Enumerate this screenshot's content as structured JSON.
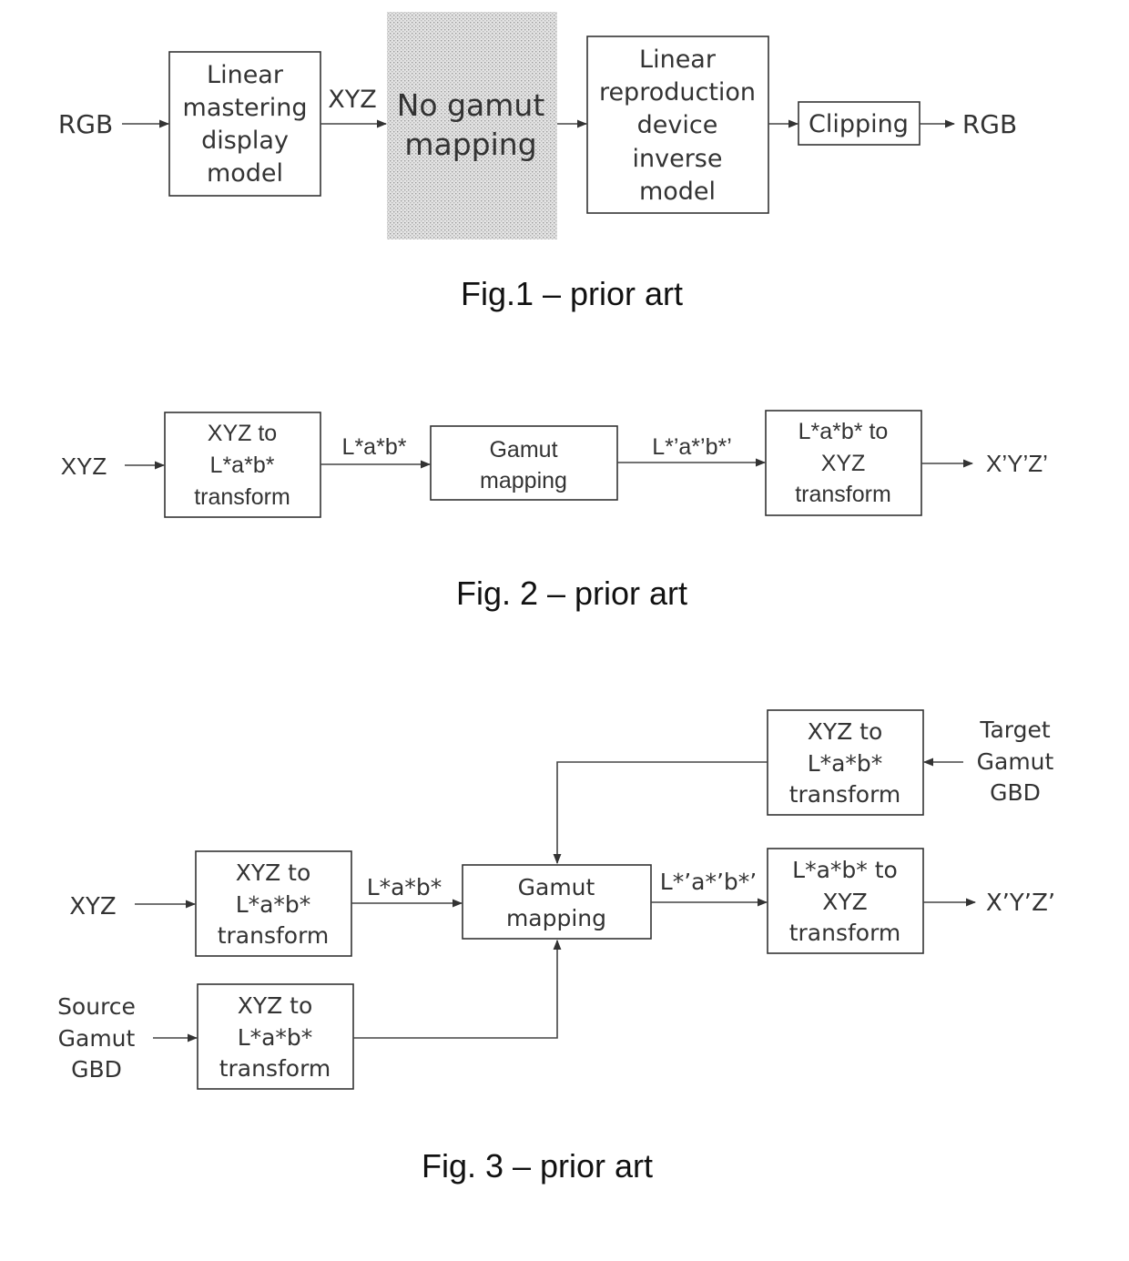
{
  "figures": [
    {
      "id": "fig1",
      "caption": "Fig.1 – prior art",
      "input_label": "RGB",
      "output_label": "RGB",
      "edge_labels": {
        "xyz": "XYZ"
      },
      "blocks": [
        {
          "id": "linear-mastering-display-model",
          "lines": [
            "Linear",
            "mastering",
            "display",
            "model"
          ]
        },
        {
          "id": "no-gamut-mapping",
          "lines": [
            "No gamut",
            "mapping"
          ],
          "shaded": true
        },
        {
          "id": "linear-reproduction-device-inverse-model",
          "lines": [
            "Linear",
            "reproduction",
            "device",
            "inverse",
            "model"
          ]
        },
        {
          "id": "clipping",
          "lines": [
            "Clipping"
          ]
        }
      ]
    },
    {
      "id": "fig2",
      "caption": "Fig. 2 – prior art",
      "input_label": "XYZ",
      "output_label": "X’Y’Z’",
      "edge_labels": {
        "lab": "L*a*b*",
        "lab_prime": "L*’a*’b*’"
      },
      "blocks": [
        {
          "id": "xyz-to-lab-transform",
          "lines": [
            "XYZ to",
            "L*a*b*",
            "transform"
          ]
        },
        {
          "id": "gamut-mapping",
          "lines": [
            "Gamut",
            "mapping"
          ]
        },
        {
          "id": "lab-to-xyz-transform",
          "lines": [
            "L*a*b* to",
            "XYZ",
            "transform"
          ]
        }
      ]
    },
    {
      "id": "fig3",
      "caption": "Fig. 3 – prior art",
      "input_label": "XYZ",
      "output_label": "X’Y’Z’",
      "source_label": [
        "Source",
        "Gamut",
        "GBD"
      ],
      "target_label": [
        "Target",
        "Gamut",
        "GBD"
      ],
      "edge_labels": {
        "lab": "L*a*b*",
        "lab_prime": "L*’a*’b*’"
      },
      "blocks": [
        {
          "id": "xyz-to-lab-transform-main",
          "lines": [
            "XYZ to",
            "L*a*b*",
            "transform"
          ]
        },
        {
          "id": "gamut-mapping",
          "lines": [
            "Gamut",
            "mapping"
          ]
        },
        {
          "id": "lab-to-xyz-transform",
          "lines": [
            "L*a*b* to",
            "XYZ",
            "transform"
          ]
        },
        {
          "id": "xyz-to-lab-transform-target",
          "lines": [
            "XYZ to",
            "L*a*b*",
            "transform"
          ]
        },
        {
          "id": "xyz-to-lab-transform-source",
          "lines": [
            "XYZ to",
            "L*a*b*",
            "transform"
          ]
        }
      ]
    }
  ]
}
